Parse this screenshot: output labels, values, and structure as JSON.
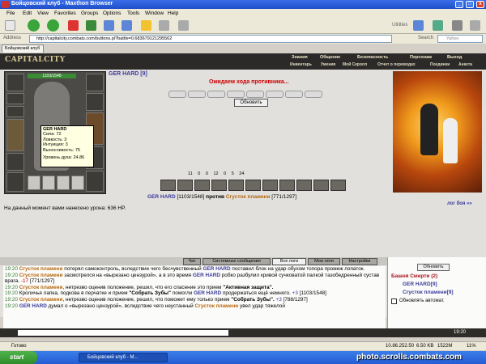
{
  "window": {
    "title": "Бойцовский клуб - Maxthon Browser",
    "min": "_",
    "max": "□",
    "close": "x"
  },
  "menu": [
    "File",
    "Edit",
    "View",
    "Favorites",
    "Groups",
    "Options",
    "Tools",
    "Window",
    "Help"
  ],
  "toolbar": {
    "utilities": "Utilities"
  },
  "address": {
    "label": "Address",
    "url": "http://capitalcity.combats.com/buttons.pl?battle=0.683679121295562",
    "search_label": "Search",
    "search_placeholder": "Yahoo"
  },
  "browser_tab": "Бойцовский клуб",
  "game": {
    "logo": "CAPITALCITY",
    "nav_top": [
      "Знания",
      "Общение",
      "Безопасность",
      "Персонаж",
      "Выход"
    ],
    "nav_bottom": [
      "Инвентарь",
      "Умения",
      "Мой Скролл",
      "Отчет о переводах",
      "Поединки",
      "Анкета"
    ],
    "hp": "1103/1548",
    "player_name": "GER HARD [9]",
    "tooltip": {
      "name": "GER HARD",
      "strength": "Сила: 72",
      "agility": "Ловкость: 3",
      "intuition": "Интуиция: 3",
      "endurance": "Выносливость: 75",
      "spirit": "Уровень духа: 24.86"
    },
    "waiting": "Ожидаем хода противника...",
    "refresh_button": "Обновить",
    "stats": [
      "11",
      "0",
      "0",
      "12",
      "0",
      "5",
      "24"
    ],
    "vs": {
      "p1": "GER HARD",
      "p1_hp": "[1103/1548]",
      "word": "против",
      "p2": "Сгусток пламени",
      "p2_hp": "[771/1297]"
    },
    "damage_text": "На данный момент вами нанесено урона: 636 HP.",
    "log_link": "лог боя »»"
  },
  "chat": {
    "tabs": [
      "Чат",
      "Системные сообщения",
      "Все логи",
      "Мои логи",
      "Настройки"
    ],
    "lines": [
      {
        "time": "19:20",
        "who": "Сгусток пламени",
        "text": "потерял самоконтроль, вследствие чего бесчувственный",
        "who2": "GER HARD",
        "text2": "поставил блок на удар обухом топора промеж лопаток."
      },
      {
        "time": "19:20",
        "who": "Сгусток пламени",
        "text": "засмотрелся на «вырезано цензурой», а в это время",
        "who2": "GER HARD",
        "text2": "робко разбулил кривой сучковатой палкой тазобедренный сустав врага.",
        "num": "-17",
        "hp": "[771/1297]"
      },
      {
        "time": "19:20",
        "who": "Сгусток пламени",
        "text": ", нетрезво оценив положение, решил, что его спасение это прием",
        "bold": "\"Активная защита\"."
      },
      {
        "time": "19:20",
        "text": "Кроличья лапка, подкова в перчатке и прием",
        "bold": "\"Собрать Зубы\"",
        "text2": "помогли",
        "who2": "GER HARD",
        "text3": "продержаться ещё немного.",
        "num": "+3",
        "hp": "[1103/1548]"
      },
      {
        "time": "19:20",
        "who": "Сгусток пламени",
        "text": ", нетрезво оценив положение, решил, что поможет ему только прием",
        "bold": "\"Собрать Зубы\".",
        "num": "+3",
        "hp": "[788/1297]"
      },
      {
        "time": "19:20",
        "who": "GER HARD",
        "text": "думал о «вырезано цензурой», вследствие чего неустанный",
        "who2": "Сгусток пламени",
        "text2": "увел удар тяжелой"
      }
    ]
  },
  "side": {
    "refresh": "Обновить",
    "tower": "Башня Смерти (2)",
    "member1": "GER HARD[9]",
    "member2": "Сгусток пламени[9]",
    "auto": "Обновлять автомат."
  },
  "clock": "19:20",
  "status": {
    "ready": "Готово",
    "ip": "10.86.252.50",
    "kb": "6.50 KB",
    "mem": "1522M",
    "zoom": "11%"
  },
  "taskbar": {
    "start": "start",
    "task": "Бойцовский клуб - M...",
    "watermark": "photo.scrolls.combats.com"
  }
}
